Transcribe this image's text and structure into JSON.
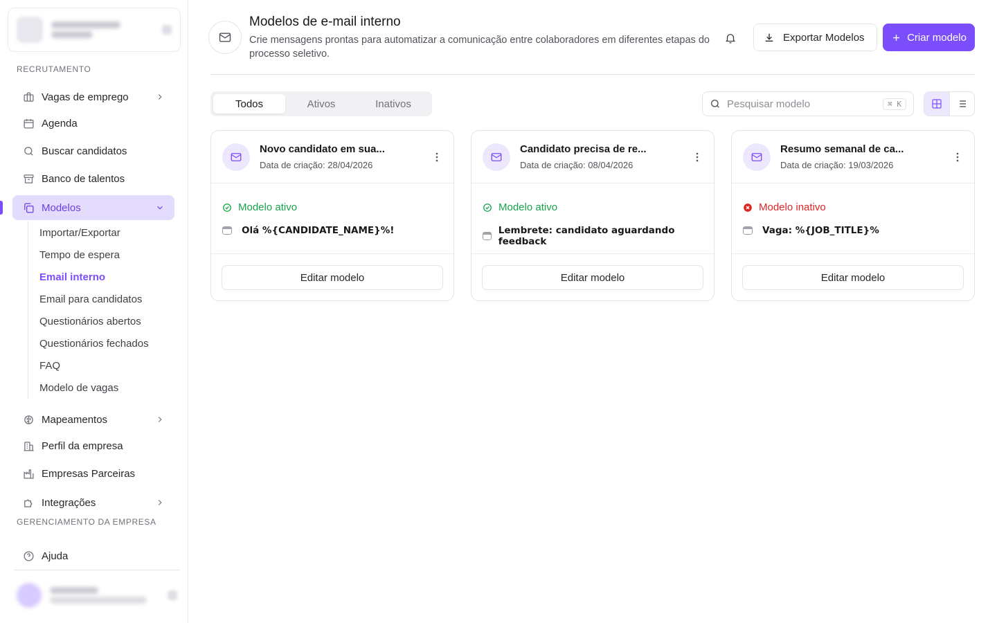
{
  "sidebar": {
    "sections": {
      "recruitment": "RECRUTAMENTO",
      "company": "GERENCIAMENTO DA EMPRESA"
    },
    "items": [
      {
        "label": "Vagas de emprego",
        "icon": "briefcase-icon"
      },
      {
        "label": "Agenda",
        "icon": "calendar-icon"
      },
      {
        "label": "Buscar candidatos",
        "icon": "search-icon"
      },
      {
        "label": "Banco de talentos",
        "icon": "archive-icon"
      },
      {
        "label": "Modelos",
        "icon": "copy-icon"
      },
      {
        "label": "Mapeamentos",
        "icon": "brain-icon"
      },
      {
        "label": "Perfil da empresa",
        "icon": "building-icon"
      },
      {
        "label": "Empresas Parceiras",
        "icon": "factory-icon"
      },
      {
        "label": "Integrações",
        "icon": "puzzle-icon"
      },
      {
        "label": "Ajuda",
        "icon": "help-circle-icon"
      }
    ],
    "subitems": [
      "Importar/Exportar",
      "Tempo de espera",
      "Email interno",
      "Email para candidatos",
      "Questionários abertos",
      "Questionários fechados",
      "FAQ",
      "Modelo de vagas"
    ]
  },
  "header": {
    "title": "Modelos de e-mail interno",
    "description": "Crie mensagens prontas para automatizar a comunicação entre colaboradores em diferentes etapas do processo seletivo.",
    "export_label": "Exportar Modelos",
    "create_label": "Criar modelo"
  },
  "filters": {
    "tabs": [
      "Todos",
      "Ativos",
      "Inativos"
    ],
    "search_placeholder": "Pesquisar modelo",
    "shortcut": "⌘ K"
  },
  "cards": [
    {
      "title": "Novo candidato em sua...",
      "date": "Data de criação: 28/04/2026",
      "status": "Modelo ativo",
      "subject": "Olá %{CANDIDATE_NAME}%!",
      "edit": "Editar modelo"
    },
    {
      "title": "Candidato precisa de re...",
      "date": "Data de criação: 08/04/2026",
      "status": "Modelo ativo",
      "subject": "Lembrete: candidato aguardando feedback",
      "edit": "Editar modelo"
    },
    {
      "title": "Resumo semanal de ca...",
      "date": "Data de criação: 19/03/2026",
      "status": "Modelo inativo",
      "subject": "Vaga: %{JOB_TITLE}%",
      "edit": "Editar modelo"
    }
  ],
  "colors": {
    "accent": "#7c4dfa",
    "active": "#16a34a",
    "inactive": "#dc2626"
  }
}
